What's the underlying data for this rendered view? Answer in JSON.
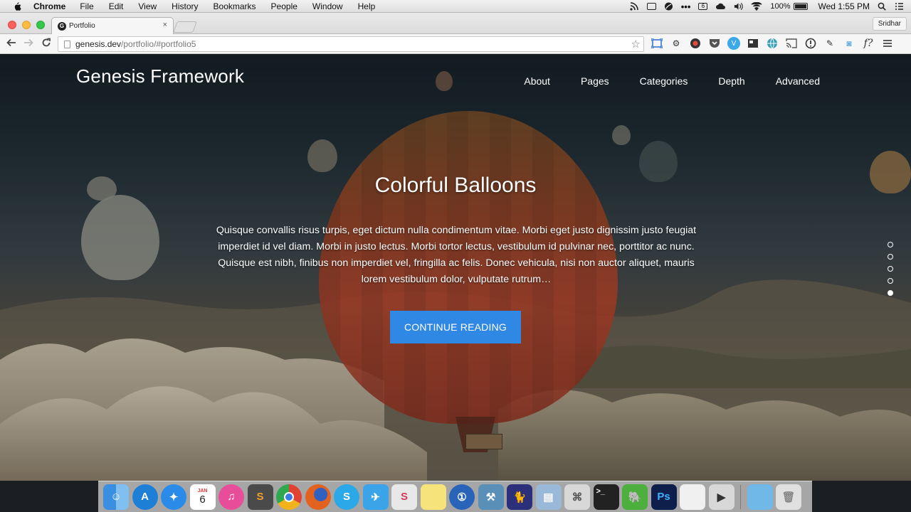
{
  "menubar": {
    "app_name": "Chrome",
    "items": [
      "File",
      "Edit",
      "View",
      "History",
      "Bookmarks",
      "People",
      "Window",
      "Help"
    ],
    "status": {
      "battery": "100%",
      "clock": "Wed 1:55 PM",
      "calendar_badge": "6"
    }
  },
  "browser": {
    "tab_title": "Portfolio",
    "tab_favicon": "G",
    "tab_close": "×",
    "profile": "Sridhar",
    "url_host": "genesis.dev",
    "url_path": "/portfolio/#portfolio5",
    "extensions": [
      "fit-icon",
      "gear-icon",
      "record-icon",
      "pocket-icon",
      "v-icon",
      "bookmark-icon",
      "globe-icon",
      "cast-icon",
      "info-icon",
      "puzzle-icon",
      "camera-icon",
      "f?",
      "menu-icon"
    ]
  },
  "site": {
    "title": "Genesis Framework",
    "nav": [
      "About",
      "Pages",
      "Categories",
      "Depth",
      "Advanced"
    ],
    "hero": {
      "title": "Colorful Balloons",
      "text": "Quisque convallis risus turpis, eget dictum nulla condimentum vitae. Morbi eget justo dignissim justo feugiat imperdiet id vel diam. Morbi in justo lectus. Morbi tortor lectus, vestibulum id pulvinar nec, porttitor ac nunc. Quisque est nibh, finibus non imperdiet vel, fringilla ac felis. Donec vehicula, nisi non auctor aliquet, mauris lorem vestibulum dolor, vulputate rutrum…",
      "cta": "CONTINUE READING"
    },
    "slide_count": 5,
    "active_slide": 5
  },
  "dock": {
    "calendar_month": "JAN",
    "calendar_day": "6",
    "apps": [
      {
        "name": "finder",
        "color": "#3b8fe0"
      },
      {
        "name": "appstore",
        "color": "#1d7fd6"
      },
      {
        "name": "safari",
        "color": "#2a8be8"
      },
      {
        "name": "calendar",
        "color": "#ffffff"
      },
      {
        "name": "itunes",
        "color": "#e84d9a"
      },
      {
        "name": "sublime",
        "color": "#4a4a4a"
      },
      {
        "name": "chrome",
        "color": "#e8b42a"
      },
      {
        "name": "firefox",
        "color": "#e2621f"
      },
      {
        "name": "skype",
        "color": "#2aa8e8"
      },
      {
        "name": "twitter",
        "color": "#3ba3e8"
      },
      {
        "name": "slack",
        "color": "#e8e8e8"
      },
      {
        "name": "notes",
        "color": "#f6e37a"
      },
      {
        "name": "1password",
        "color": "#2a64b8"
      },
      {
        "name": "xcode",
        "color": "#5a8fb8"
      },
      {
        "name": "tiddlywiki",
        "color": "#2c2f7a"
      },
      {
        "name": "preview",
        "color": "#9ab8d8"
      },
      {
        "name": "scripteditor",
        "color": "#d8d8d8"
      },
      {
        "name": "terminal",
        "color": "#222222"
      },
      {
        "name": "evernote",
        "color": "#4caf3e"
      },
      {
        "name": "photoshop",
        "color": "#0d1f4a"
      },
      {
        "name": "textedit",
        "color": "#f0f0f0"
      },
      {
        "name": "photo-booth",
        "color": "#d8d8d8"
      },
      {
        "name": "folder",
        "color": "#6fb8e8"
      },
      {
        "name": "trash",
        "color": "#e0e0e0"
      }
    ],
    "ps_label": "Ps"
  }
}
